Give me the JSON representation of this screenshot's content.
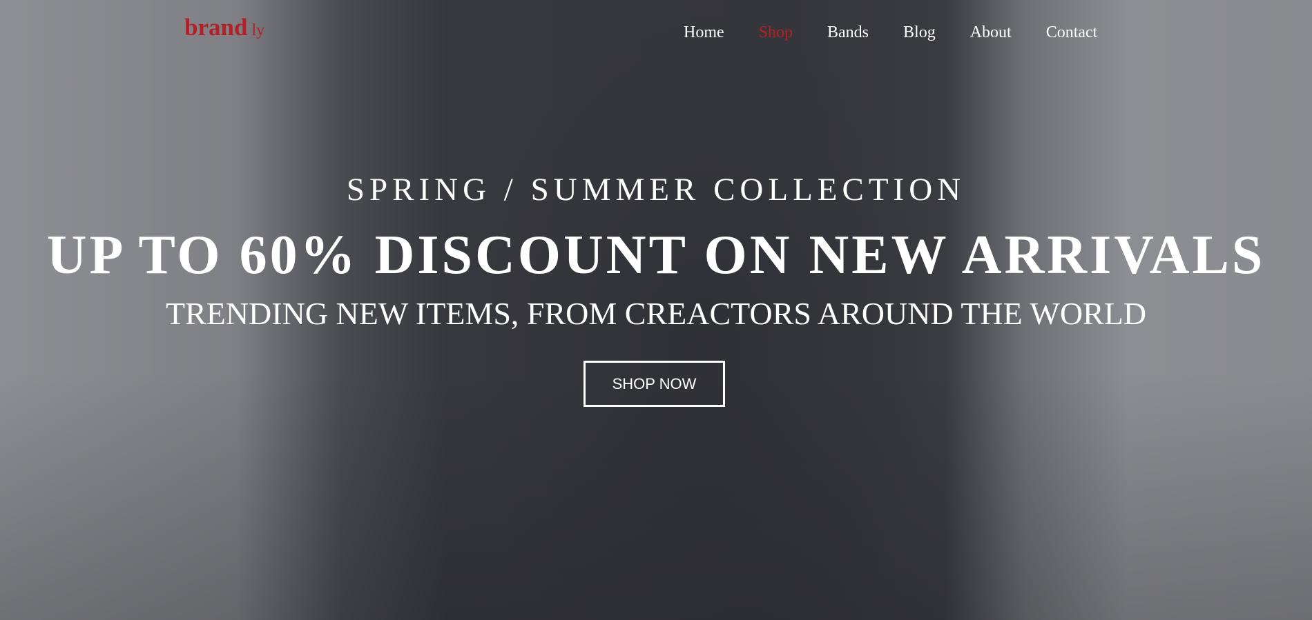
{
  "brand": {
    "name": "brand",
    "suffix": "ly",
    "color": "#b52027"
  },
  "nav": {
    "items": [
      {
        "label": "Home"
      },
      {
        "label": "Shop",
        "active": true
      },
      {
        "label": "Bands"
      },
      {
        "label": "Blog"
      },
      {
        "label": "About"
      },
      {
        "label": "Contact"
      }
    ]
  },
  "hero": {
    "subtitle": "SPRING / SUMMER COLLECTION",
    "headline": "UP TO 60% DISCOUNT ON NEW ARRIVALS",
    "tagline": "TRENDING NEW ITEMS, FROM CREACTORS AROUND THE WORLD",
    "cta_label": "SHOP NOW"
  }
}
